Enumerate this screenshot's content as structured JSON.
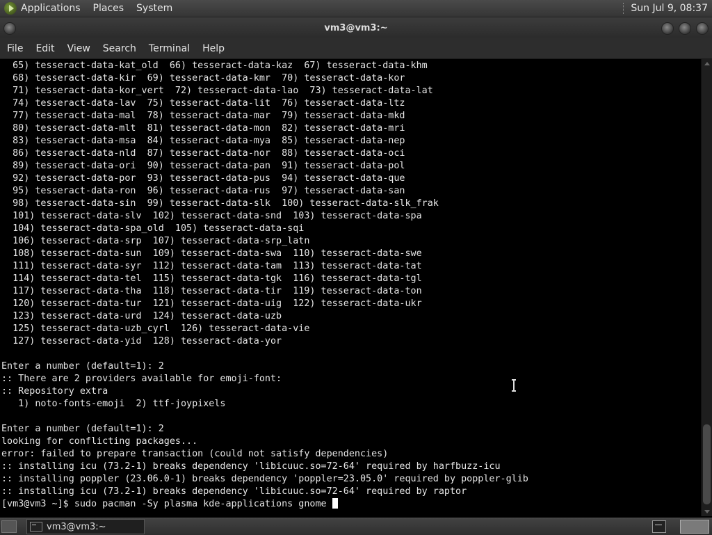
{
  "top_panel": {
    "menus": [
      "Applications",
      "Places",
      "System"
    ],
    "clock": "Sun Jul  9, 08:37"
  },
  "window": {
    "title": "vm3@vm3:~"
  },
  "menubar": [
    "File",
    "Edit",
    "View",
    "Search",
    "Terminal",
    "Help"
  ],
  "terminal": {
    "lines": [
      "  65) tesseract-data-kat_old  66) tesseract-data-kaz  67) tesseract-data-khm",
      "  68) tesseract-data-kir  69) tesseract-data-kmr  70) tesseract-data-kor",
      "  71) tesseract-data-kor_vert  72) tesseract-data-lao  73) tesseract-data-lat",
      "  74) tesseract-data-lav  75) tesseract-data-lit  76) tesseract-data-ltz",
      "  77) tesseract-data-mal  78) tesseract-data-mar  79) tesseract-data-mkd",
      "  80) tesseract-data-mlt  81) tesseract-data-mon  82) tesseract-data-mri",
      "  83) tesseract-data-msa  84) tesseract-data-mya  85) tesseract-data-nep",
      "  86) tesseract-data-nld  87) tesseract-data-nor  88) tesseract-data-oci",
      "  89) tesseract-data-ori  90) tesseract-data-pan  91) tesseract-data-pol",
      "  92) tesseract-data-por  93) tesseract-data-pus  94) tesseract-data-que",
      "  95) tesseract-data-ron  96) tesseract-data-rus  97) tesseract-data-san",
      "  98) tesseract-data-sin  99) tesseract-data-slk  100) tesseract-data-slk_frak",
      "  101) tesseract-data-slv  102) tesseract-data-snd  103) tesseract-data-spa",
      "  104) tesseract-data-spa_old  105) tesseract-data-sqi",
      "  106) tesseract-data-srp  107) tesseract-data-srp_latn",
      "  108) tesseract-data-sun  109) tesseract-data-swa  110) tesseract-data-swe",
      "  111) tesseract-data-syr  112) tesseract-data-tam  113) tesseract-data-tat",
      "  114) tesseract-data-tel  115) tesseract-data-tgk  116) tesseract-data-tgl",
      "  117) tesseract-data-tha  118) tesseract-data-tir  119) tesseract-data-ton",
      "  120) tesseract-data-tur  121) tesseract-data-uig  122) tesseract-data-ukr",
      "  123) tesseract-data-urd  124) tesseract-data-uzb",
      "  125) tesseract-data-uzb_cyrl  126) tesseract-data-vie",
      "  127) tesseract-data-yid  128) tesseract-data-yor",
      "",
      "Enter a number (default=1): 2",
      ":: There are 2 providers available for emoji-font:",
      ":: Repository extra",
      "   1) noto-fonts-emoji  2) ttf-joypixels",
      "",
      "Enter a number (default=1): 2",
      "looking for conflicting packages...",
      "error: failed to prepare transaction (could not satisfy dependencies)",
      ":: installing icu (73.2-1) breaks dependency 'libicuuc.so=72-64' required by harfbuzz-icu",
      ":: installing poppler (23.06.0-1) breaks dependency 'poppler=23.05.0' required by poppler-glib",
      ":: installing icu (73.2-1) breaks dependency 'libicuuc.so=72-64' required by raptor"
    ],
    "prompt": "[vm3@vm3 ~]$ ",
    "command": "sudo pacman -Sy plasma kde-applications gnome "
  },
  "taskbar": {
    "item_label": "vm3@vm3:~"
  }
}
